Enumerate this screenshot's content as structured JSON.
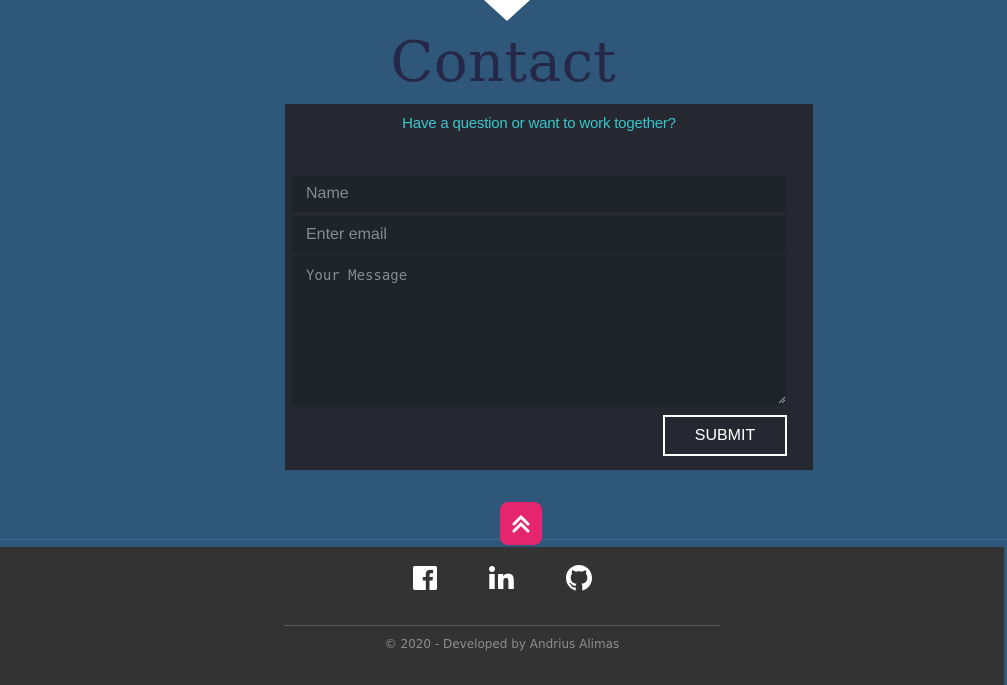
{
  "contact": {
    "title": "Contact",
    "subtitle": "Have a question or want to work together?"
  },
  "form": {
    "name_placeholder": "Name",
    "email_placeholder": "Enter email",
    "message_placeholder": "Your Message",
    "submit_label": "SUBMIT"
  },
  "scroll_top": {
    "icon": "double-chevron-up-icon",
    "color": "#e5266f"
  },
  "footer": {
    "social": [
      {
        "name": "facebook",
        "icon": "facebook-icon"
      },
      {
        "name": "linkedin",
        "icon": "linkedin-icon"
      },
      {
        "name": "github",
        "icon": "github-icon"
      }
    ],
    "copyright": "© 2020 - Developed by Andrius Alimas"
  },
  "colors": {
    "background": "#2e5779",
    "title": "#262847",
    "card": "#252830",
    "field": "#1f232a",
    "accent": "#3ac4c9",
    "footer": "#333333"
  }
}
